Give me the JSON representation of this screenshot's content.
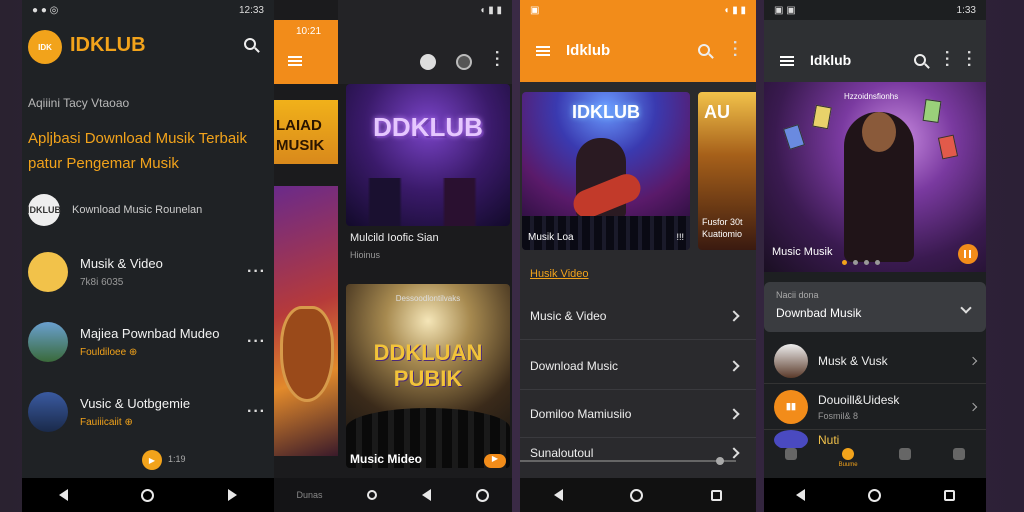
{
  "screen1": {
    "status_time": "12:33",
    "logo_text": "IDK",
    "brand": "IDKLUB",
    "subtitle": "Aqiiini Tacy Vtaoao",
    "headline": "Apljbasi Download Musik Terbaik patur Pengemar Musik",
    "rows": [
      {
        "title": "Kownload Music Rounelan",
        "sub": "",
        "avatar": "IDKLUB"
      },
      {
        "title": "Musik & Video",
        "sub": "7k8i 6035",
        "avatar": ""
      },
      {
        "title": "Majiea Pownbad Mudeo",
        "sub": "Fouldiloee ⊕",
        "avatar": ""
      },
      {
        "title": "Vusic & Uotbgemie",
        "sub": "Fauiiicaiit ⊕",
        "avatar": ""
      }
    ],
    "fab_label": "1:19"
  },
  "screen2": {
    "status_time": "10:21",
    "side_card_text": "LAIAD MUSIK",
    "poster1_title": "DDKLUB",
    "poster1_caption": "Mulcild Ioofic Sian",
    "poster1_sub": "Hioinus",
    "poster2_top": "Dessoodlontilvaks",
    "poster2_title": "DDKLUAN",
    "poster2_title2": "PUBIK",
    "poster2_caption": "Music Mideo",
    "bottom_label": "Dunas"
  },
  "screen3": {
    "title": "Idklub",
    "hero_title": "IDKLUB",
    "hero_caption": "Musik Loa",
    "hero_tag": "!!!",
    "hero2_title": "AU",
    "hero2_caption": "Fusfor 30t Kuatiomio",
    "section": "Husik Video",
    "items": [
      "Music & Video",
      "Download Music",
      "Domiloo Mamiusiio",
      "Sunaloutoul"
    ]
  },
  "screen4": {
    "status_time": "1:33",
    "title": "Idklub",
    "hero_top": "Hzzoidnsfionhs",
    "hero_caption": "Music Musik",
    "dropdown_label": "Nacii dona",
    "dropdown_value": "Downbad Musik",
    "rows": [
      {
        "title": "Musk & Vusk",
        "sub": ""
      },
      {
        "title": "Douoill&Uidesk",
        "sub": "Fosmil& 8"
      },
      {
        "title": "Nuti",
        "sub": ""
      }
    ],
    "tabs": [
      "",
      "Buume",
      "",
      ""
    ]
  }
}
